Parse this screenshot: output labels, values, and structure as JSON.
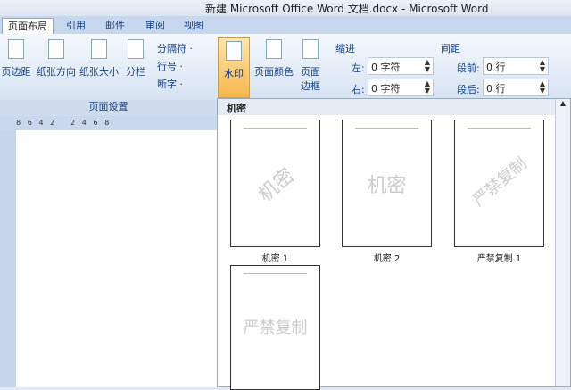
{
  "title": "新建 Microsoft Office Word 文档.docx - Microsoft Word",
  "tabs": [
    "页面布局",
    "引用",
    "邮件",
    "审阅",
    "视图"
  ],
  "ribbon": {
    "page_setup": [
      "页边距",
      "纸张方向",
      "纸张大小",
      "分栏"
    ],
    "small": [
      "分隔符 ·",
      "行号 ·",
      "断字 ·"
    ],
    "watermark": "水印",
    "page_color": "页面颜色",
    "page_border": [
      "页面",
      "边框"
    ],
    "indent": {
      "title": "缩进",
      "left_label": "左:",
      "left": "0 字符",
      "right_label": "右:",
      "right": "0 字符"
    },
    "spacing": {
      "title": "间距",
      "before_label": "段前:",
      "before": "0 行",
      "after_label": "段后:",
      "after": "0 行"
    },
    "group_label": "页面设置"
  },
  "ruler": "8   6   4   2       2   4   6   8",
  "gallery": {
    "header": "机密",
    "items": [
      {
        "caption": "机密 1",
        "watermark": "机密"
      },
      {
        "caption": "机密 2",
        "watermark": "机密"
      },
      {
        "caption": "严禁复制 1",
        "watermark": "严禁复制"
      },
      {
        "caption": "",
        "watermark": "严禁复制"
      }
    ]
  }
}
